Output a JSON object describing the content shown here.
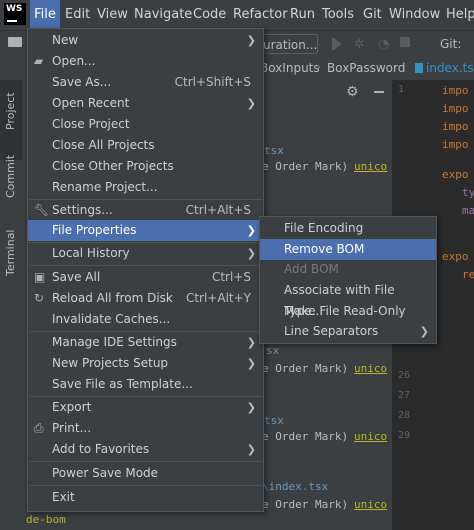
{
  "menubar": {
    "logo": "WS",
    "items": [
      "File",
      "Edit",
      "View",
      "Navigate",
      "Code",
      "Refactor",
      "Run",
      "Tools",
      "Git",
      "Window",
      "Help"
    ]
  },
  "toolbar": {
    "run_config": "uration...",
    "git_label": "Git:"
  },
  "breadcrumb": {
    "items": [
      "BoxInputs",
      "BoxPassword",
      "index.tsx"
    ]
  },
  "side_tabs": {
    "project": "Project",
    "commit": "Commit",
    "terminal": "Terminal"
  },
  "tree_fragments": {
    "f1": "tsx",
    "f2": "e Order Mark)",
    "f3": "unico",
    "f4": "sx",
    "f5": "e Order Mark)",
    "f6": "unico",
    "f7": "tsx",
    "f8": "e Order Mark)",
    "f9": "unico",
    "f10": "\\index.tsx",
    "f11": "e Order Mark)",
    "f12": "unico",
    "f13": "de-bom"
  },
  "editor": {
    "line_numbers": [
      "1",
      "26",
      "27",
      "28",
      "29"
    ],
    "code_lines": [
      "impo",
      "impo",
      "impo",
      "impo",
      "expo",
      "ty",
      "ma",
      "expo",
      "re"
    ]
  },
  "file_menu": {
    "items": [
      {
        "label": "New",
        "arrow": true
      },
      {
        "label": "Open...",
        "icon": "folder-icon"
      },
      {
        "label": "Save As...",
        "shortcut": "Ctrl+Shift+S"
      },
      {
        "label": "Open Recent",
        "arrow": true
      },
      {
        "label": "Close Project"
      },
      {
        "label": "Close All Projects"
      },
      {
        "label": "Close Other Projects"
      },
      {
        "label": "Rename Project..."
      },
      {
        "label": "Settings...",
        "shortcut": "Ctrl+Alt+S",
        "icon": "wrench-icon"
      },
      {
        "label": "File Properties",
        "arrow": true
      },
      {
        "label": "Local History",
        "arrow": true
      },
      {
        "label": "Save All",
        "shortcut": "Ctrl+S",
        "icon": "save-icon"
      },
      {
        "label": "Reload All from Disk",
        "shortcut": "Ctrl+Alt+Y",
        "icon": "reload-icon"
      },
      {
        "label": "Invalidate Caches..."
      },
      {
        "label": "Manage IDE Settings",
        "arrow": true
      },
      {
        "label": "New Projects Setup",
        "arrow": true
      },
      {
        "label": "Save File as Template..."
      },
      {
        "label": "Export",
        "arrow": true
      },
      {
        "label": "Print...",
        "icon": "print-icon"
      },
      {
        "label": "Add to Favorites",
        "arrow": true
      },
      {
        "label": "Power Save Mode"
      },
      {
        "label": "Exit"
      }
    ]
  },
  "file_properties_menu": {
    "items": [
      {
        "label": "File Encoding"
      },
      {
        "label": "Remove BOM"
      },
      {
        "label": "Add BOM"
      },
      {
        "label": "Associate with File Type..."
      },
      {
        "label": "Make File Read-Only"
      },
      {
        "label": "Line Separators",
        "arrow": true
      }
    ]
  }
}
